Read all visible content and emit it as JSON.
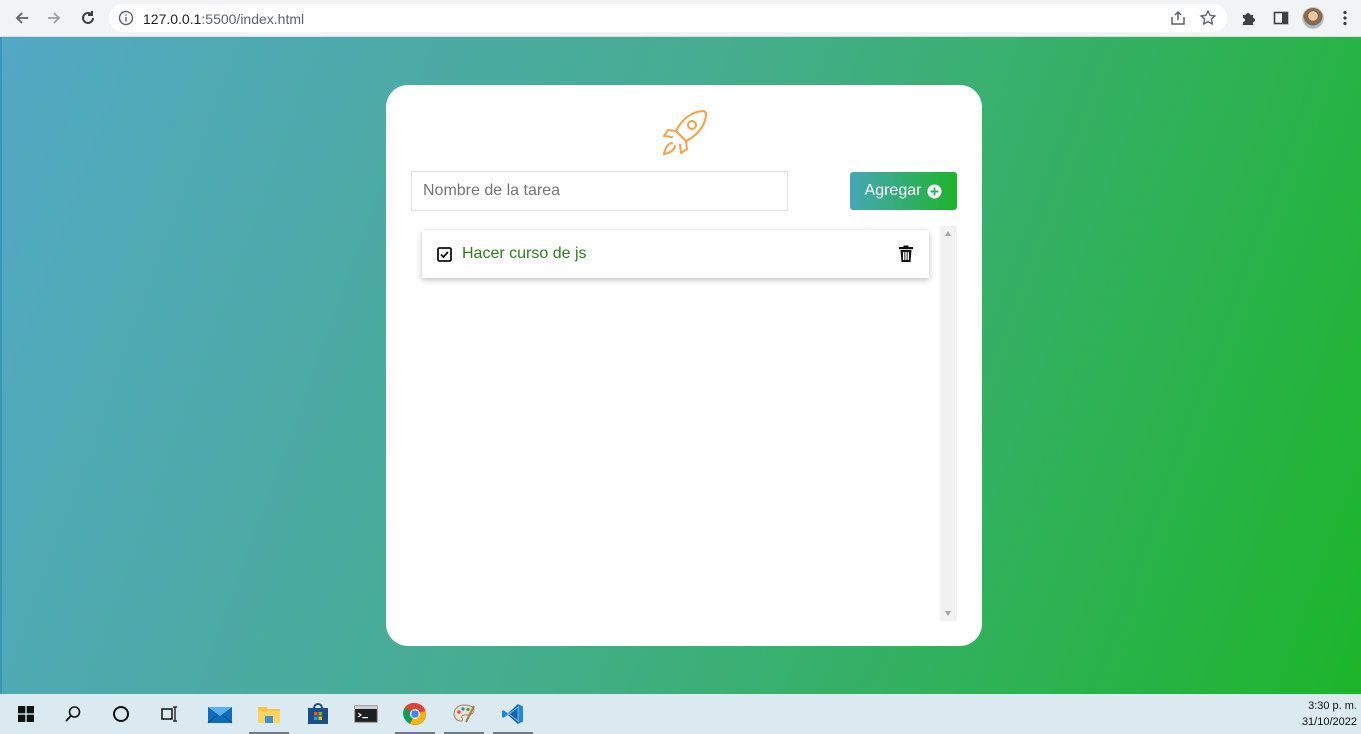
{
  "browser": {
    "url_host": "127.0.0.1",
    "url_rest": ":5500/index.html"
  },
  "app": {
    "input_placeholder": "Nombre de la tarea",
    "input_value": "",
    "add_button_label": "Agregar",
    "tasks": [
      {
        "text": "Hacer curso de js",
        "done": true
      }
    ]
  },
  "colors": {
    "accent_start": "#46a7b6",
    "accent_end": "#1eb32c",
    "rocket": "#f5a14a",
    "task_text": "#2e7d1f"
  },
  "icons": {
    "rocket": "rocket-icon",
    "add": "plus-circle-icon",
    "check": "checkbox-checked-icon",
    "delete": "trash-icon"
  },
  "taskbar": {
    "time": "3:30 p. m.",
    "date": "31/10/2022"
  }
}
